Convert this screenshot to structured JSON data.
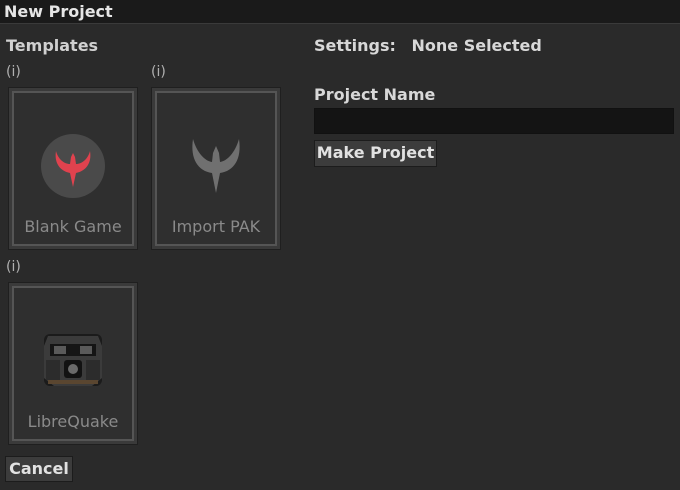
{
  "window": {
    "title": "New Project"
  },
  "templates": {
    "heading": "Templates",
    "info_marker": "(i)",
    "items": [
      {
        "label": "Blank Game",
        "icon": "red-quake-logo-icon"
      },
      {
        "label": "Import PAK",
        "icon": "gray-quake-logo-icon"
      },
      {
        "label": "LibreQuake",
        "icon": "librequake-helmet-icon"
      }
    ]
  },
  "settings": {
    "label": "Settings:",
    "value": "None Selected"
  },
  "project_name": {
    "label": "Project Name",
    "value": "",
    "placeholder": ""
  },
  "buttons": {
    "make_project": "Make Project",
    "cancel": "Cancel"
  },
  "colors": {
    "accent_red": "#e0424e",
    "background": "#2a2a2a",
    "titlebar": "#1a1a1a"
  }
}
